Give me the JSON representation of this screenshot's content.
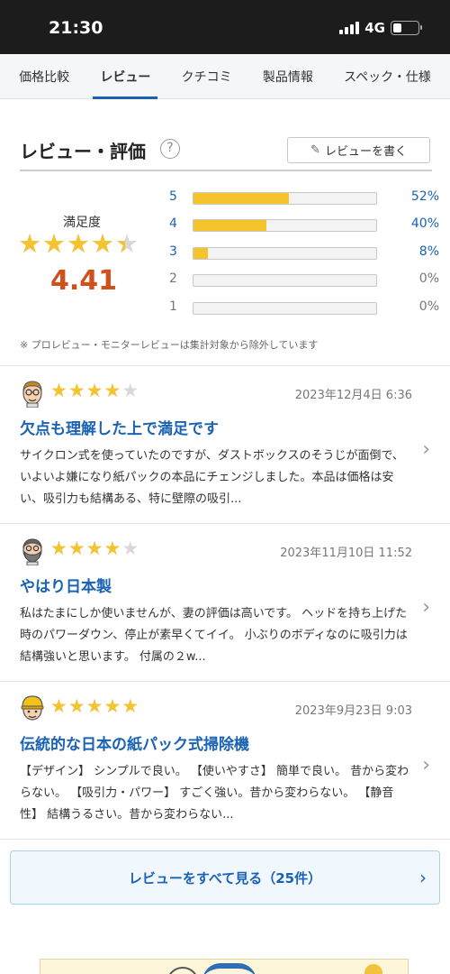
{
  "status_bar": {
    "time": "21:30",
    "network": "4G",
    "icons": [
      "signal-icon",
      "battery-icon"
    ]
  },
  "tabs": [
    {
      "label": "価格比較",
      "active": false
    },
    {
      "label": "レビュー",
      "active": true
    },
    {
      "label": "クチコミ",
      "active": false
    },
    {
      "label": "製品情報",
      "active": false
    },
    {
      "label": "スペック・仕様",
      "active": false
    }
  ],
  "section": {
    "title": "レビュー・評価",
    "help_icon": "?",
    "write_button": "レビューを書く"
  },
  "summary": {
    "satisfaction_label": "満足度",
    "score": "4.41",
    "score_value": 4.41,
    "distribution": [
      {
        "stars": "5",
        "percent": "52%",
        "value": 52
      },
      {
        "stars": "4",
        "percent": "40%",
        "value": 40
      },
      {
        "stars": "3",
        "percent": "8%",
        "value": 8
      },
      {
        "stars": "2",
        "percent": "0%",
        "value": 0
      },
      {
        "stars": "1",
        "percent": "0%",
        "value": 0
      }
    ],
    "note": "※ プロレビュー・モニターレビューは集計対象から除外しています"
  },
  "reviews": [
    {
      "rating": 4,
      "date": "2023年12月4日 6:36",
      "title": "欠点も理解した上で満足です",
      "body": "サイクロン式を使っていたのですが、ダストボックスのそうじが面倒で、いよいよ嫌になり紙パックの本品にチェンジしました。本品は価格は安い、吸引力も結構ある、特に壁際の吸引...",
      "avatar": "avatar-glasses-man"
    },
    {
      "rating": 4,
      "date": "2023年11月10日 11:52",
      "title": "やはり日本製",
      "body": "私はたまにしか使いませんが、妻の評価は高いです。 ヘッドを持ち上げた時のパワーダウン、停止が素早くてイイ。 小ぶりのボディなのに吸引力は結構強いと思います。 付属の２w...",
      "avatar": "avatar-bearded-man"
    },
    {
      "rating": 5,
      "date": "2023年9月23日 9:03",
      "title": "伝統的な日本の紙パック式掃除機",
      "body": "【デザイン】 シンプルで良い。 【使いやすさ】 簡単で良い。 昔から変わらない。 【吸引力・パワー】 すごく強い。昔から変わらない。 【静音性】 結構うるさい。昔から変わらない...",
      "avatar": "avatar-helmet-worker"
    }
  ],
  "all_reviews_button": "レビューをすべて見る（25件）",
  "colors": {
    "accent": "#1a62b3",
    "star": "#f4c430",
    "score": "#d14f1b"
  }
}
